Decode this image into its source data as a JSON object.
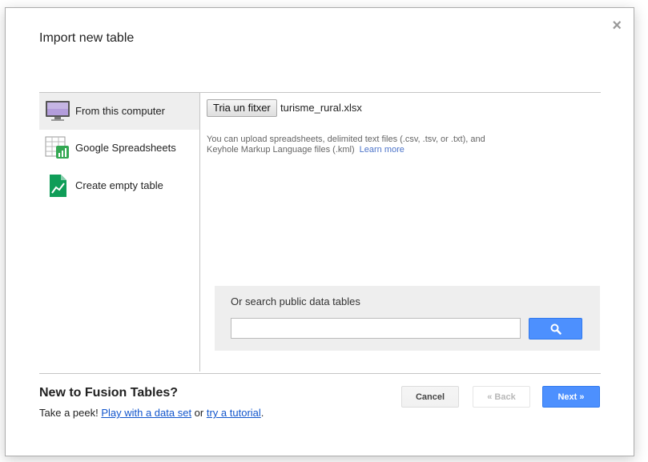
{
  "dialog": {
    "title": "Import new table",
    "close_glyph": "×"
  },
  "sidebar": {
    "items": [
      {
        "label": "From this computer",
        "icon": "monitor-icon",
        "active": true
      },
      {
        "label": "Google Spreadsheets",
        "icon": "spreadsheet-icon",
        "active": false
      },
      {
        "label": "Create empty table",
        "icon": "fusion-table-icon",
        "active": false
      }
    ]
  },
  "upload": {
    "button_label": "Tria un fitxer",
    "file_name": "turisme_rural.xlsx",
    "help_text": "You can upload spreadsheets, delimited text files (.csv, .tsv, or .txt), and Keyhole Markup Language files (.kml)",
    "learn_more": "Learn more"
  },
  "search": {
    "label": "Or search public data tables",
    "value": "",
    "button_icon": "search-icon"
  },
  "footer": {
    "title": "New to Fusion Tables?",
    "prefix": "Take a peek! ",
    "link1": "Play with a data set",
    "middle": " or ",
    "link2": "try a tutorial",
    "suffix": "."
  },
  "buttons": {
    "cancel": "Cancel",
    "back": "« Back",
    "next": "Next »"
  },
  "colors": {
    "primary": "#4d90fe",
    "link": "#1155cc"
  }
}
